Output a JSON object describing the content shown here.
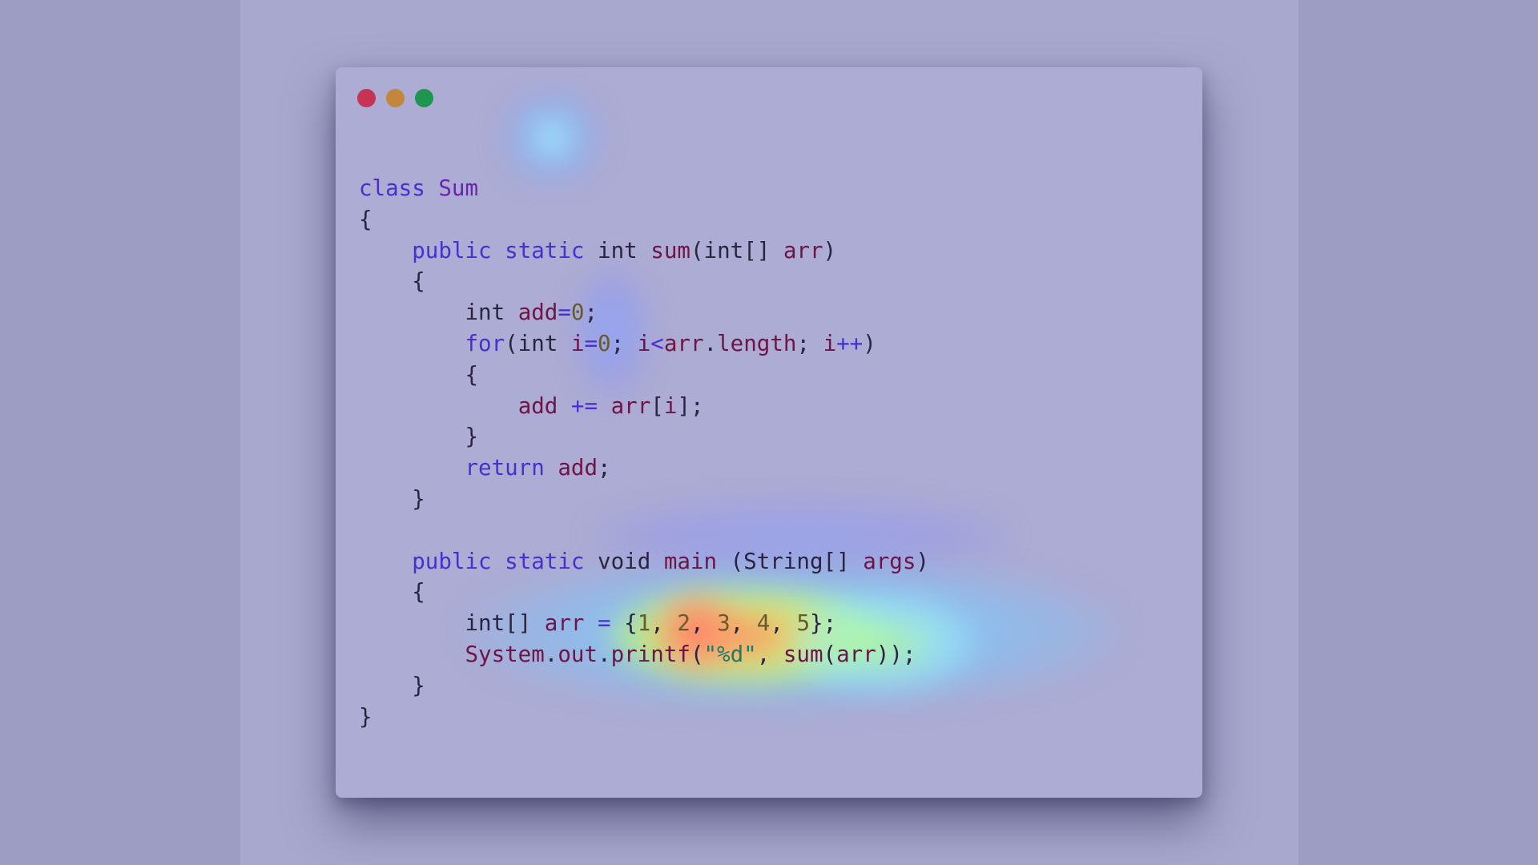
{
  "window": {
    "controls": [
      "close",
      "minimize",
      "maximize"
    ],
    "colors": {
      "close": "#c63455",
      "minimize": "#c2873c",
      "maximize": "#1f9650",
      "background": "#acacd4"
    }
  },
  "code": {
    "language": "java",
    "lines": [
      [
        {
          "t": "class",
          "c": "kw"
        },
        {
          "t": " ",
          "c": "plain"
        },
        {
          "t": "Sum",
          "c": "cls"
        }
      ],
      [
        {
          "t": "{",
          "c": "plain"
        }
      ],
      [
        {
          "t": "    ",
          "c": "plain"
        },
        {
          "t": "public",
          "c": "kw"
        },
        {
          "t": " ",
          "c": "plain"
        },
        {
          "t": "static",
          "c": "kw"
        },
        {
          "t": " int ",
          "c": "plain"
        },
        {
          "t": "sum",
          "c": "fn"
        },
        {
          "t": "(int[] ",
          "c": "plain"
        },
        {
          "t": "arr",
          "c": "var"
        },
        {
          "t": ")",
          "c": "plain"
        }
      ],
      [
        {
          "t": "    {",
          "c": "plain"
        }
      ],
      [
        {
          "t": "        int ",
          "c": "plain"
        },
        {
          "t": "add",
          "c": "var"
        },
        {
          "t": "=",
          "c": "op"
        },
        {
          "t": "0",
          "c": "num"
        },
        {
          "t": ";",
          "c": "plain"
        }
      ],
      [
        {
          "t": "        ",
          "c": "plain"
        },
        {
          "t": "for",
          "c": "kw"
        },
        {
          "t": "(int ",
          "c": "plain"
        },
        {
          "t": "i",
          "c": "var"
        },
        {
          "t": "=",
          "c": "op"
        },
        {
          "t": "0",
          "c": "num"
        },
        {
          "t": "; ",
          "c": "plain"
        },
        {
          "t": "i",
          "c": "var"
        },
        {
          "t": "<",
          "c": "op"
        },
        {
          "t": "arr",
          "c": "var"
        },
        {
          "t": ".",
          "c": "plain"
        },
        {
          "t": "length",
          "c": "var"
        },
        {
          "t": "; ",
          "c": "plain"
        },
        {
          "t": "i",
          "c": "var"
        },
        {
          "t": "++",
          "c": "op"
        },
        {
          "t": ")",
          "c": "plain"
        }
      ],
      [
        {
          "t": "        {",
          "c": "plain"
        }
      ],
      [
        {
          "t": "            ",
          "c": "plain"
        },
        {
          "t": "add",
          "c": "var"
        },
        {
          "t": " ",
          "c": "plain"
        },
        {
          "t": "+=",
          "c": "op"
        },
        {
          "t": " ",
          "c": "plain"
        },
        {
          "t": "arr",
          "c": "var"
        },
        {
          "t": "[",
          "c": "plain"
        },
        {
          "t": "i",
          "c": "var"
        },
        {
          "t": "];",
          "c": "plain"
        }
      ],
      [
        {
          "t": "        }",
          "c": "plain"
        }
      ],
      [
        {
          "t": "        ",
          "c": "plain"
        },
        {
          "t": "return",
          "c": "kw"
        },
        {
          "t": " ",
          "c": "plain"
        },
        {
          "t": "add",
          "c": "var"
        },
        {
          "t": ";",
          "c": "plain"
        }
      ],
      [
        {
          "t": "    }",
          "c": "plain"
        }
      ],
      [
        {
          "t": "",
          "c": "plain"
        }
      ],
      [
        {
          "t": "    ",
          "c": "plain"
        },
        {
          "t": "public",
          "c": "kw"
        },
        {
          "t": " ",
          "c": "plain"
        },
        {
          "t": "static",
          "c": "kw"
        },
        {
          "t": " void ",
          "c": "plain"
        },
        {
          "t": "main",
          "c": "fn"
        },
        {
          "t": " (String[] ",
          "c": "plain"
        },
        {
          "t": "args",
          "c": "var"
        },
        {
          "t": ")",
          "c": "plain"
        }
      ],
      [
        {
          "t": "    {",
          "c": "plain"
        }
      ],
      [
        {
          "t": "        int[] ",
          "c": "plain"
        },
        {
          "t": "arr",
          "c": "var"
        },
        {
          "t": " ",
          "c": "plain"
        },
        {
          "t": "=",
          "c": "op"
        },
        {
          "t": " {",
          "c": "plain"
        },
        {
          "t": "1",
          "c": "num"
        },
        {
          "t": ", ",
          "c": "plain"
        },
        {
          "t": "2",
          "c": "num"
        },
        {
          "t": ", ",
          "c": "plain"
        },
        {
          "t": "3",
          "c": "num"
        },
        {
          "t": ", ",
          "c": "plain"
        },
        {
          "t": "4",
          "c": "num"
        },
        {
          "t": ", ",
          "c": "plain"
        },
        {
          "t": "5",
          "c": "num"
        },
        {
          "t": "};",
          "c": "plain"
        }
      ],
      [
        {
          "t": "        ",
          "c": "plain"
        },
        {
          "t": "System",
          "c": "var"
        },
        {
          "t": ".",
          "c": "plain"
        },
        {
          "t": "out",
          "c": "var"
        },
        {
          "t": ".",
          "c": "plain"
        },
        {
          "t": "printf",
          "c": "fn"
        },
        {
          "t": "(",
          "c": "plain"
        },
        {
          "t": "\"%d\"",
          "c": "str"
        },
        {
          "t": ", ",
          "c": "plain"
        },
        {
          "t": "sum",
          "c": "fn"
        },
        {
          "t": "(",
          "c": "plain"
        },
        {
          "t": "arr",
          "c": "var"
        },
        {
          "t": "));",
          "c": "plain"
        }
      ],
      [
        {
          "t": "    }",
          "c": "plain"
        }
      ],
      [
        {
          "t": "}",
          "c": "plain"
        }
      ]
    ]
  },
  "heatmap": {
    "colors": [
      "#7fd6ff",
      "#9cf0ff",
      "#b8ff6a",
      "#ffd23a",
      "#ff6a6a"
    ]
  }
}
